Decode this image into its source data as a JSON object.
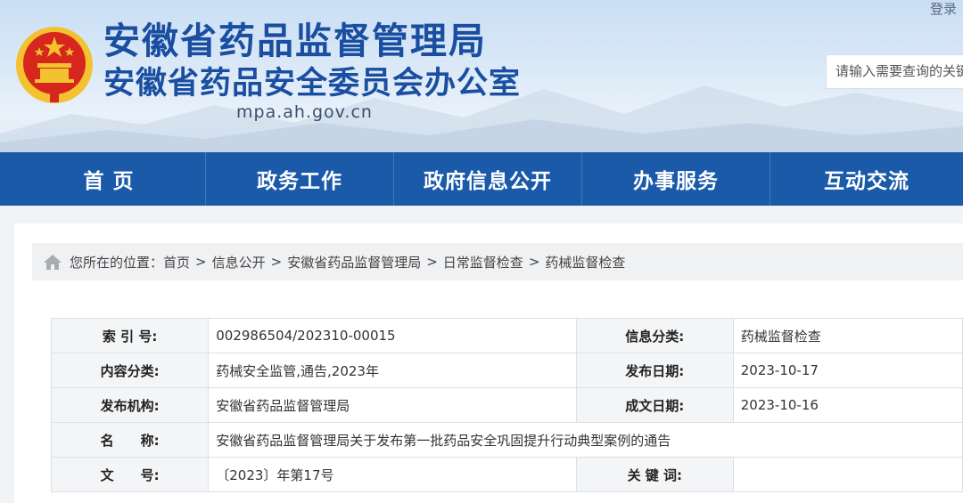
{
  "header": {
    "title_line1": "安徽省药品监督管理局",
    "title_line2": "安徽省药品安全委员会办公室",
    "domain": "mpa.ah.gov.cn",
    "login_label": "登录",
    "search_placeholder": "请输入需要查询的关键"
  },
  "nav": {
    "items": [
      {
        "label": "首 页"
      },
      {
        "label": "政务工作"
      },
      {
        "label": "政府信息公开"
      },
      {
        "label": "办事服务"
      },
      {
        "label": "互动交流"
      }
    ]
  },
  "breadcrumb": {
    "prefix": "您所在的位置：",
    "items": [
      "首页",
      "信息公开",
      "安徽省药品监督管理局",
      "日常监督检查",
      "药械监督检查"
    ],
    "separator": ">"
  },
  "meta_table": {
    "index_label": "索 引 号:",
    "index_value": "002986504/202310-00015",
    "category_label": "信息分类:",
    "category_value": "药械监督检查",
    "content_type_label": "内容分类:",
    "content_type_value": "药械安全监管,通告,2023年",
    "publish_date_label": "发布日期:",
    "publish_date_value": "2023-10-17",
    "agency_label": "发布机构:",
    "agency_value": "安徽省药品监督管理局",
    "created_date_label": "成文日期:",
    "created_date_value": "2023-10-16",
    "name_label": "名　　称:",
    "name_value": "安徽省药品监督管理局关于发布第一批药品安全巩固提升行动典型案例的通告",
    "doc_no_label": "文　　号:",
    "doc_no_value": "〔2023〕年第17号",
    "keywords_label": "关 键 词:",
    "keywords_value": ""
  },
  "colors": {
    "nav_bg": "#1b5aa9",
    "title_blue": "#1a4ea0",
    "emblem_red": "#d7261e",
    "emblem_gold": "#f2c230"
  }
}
